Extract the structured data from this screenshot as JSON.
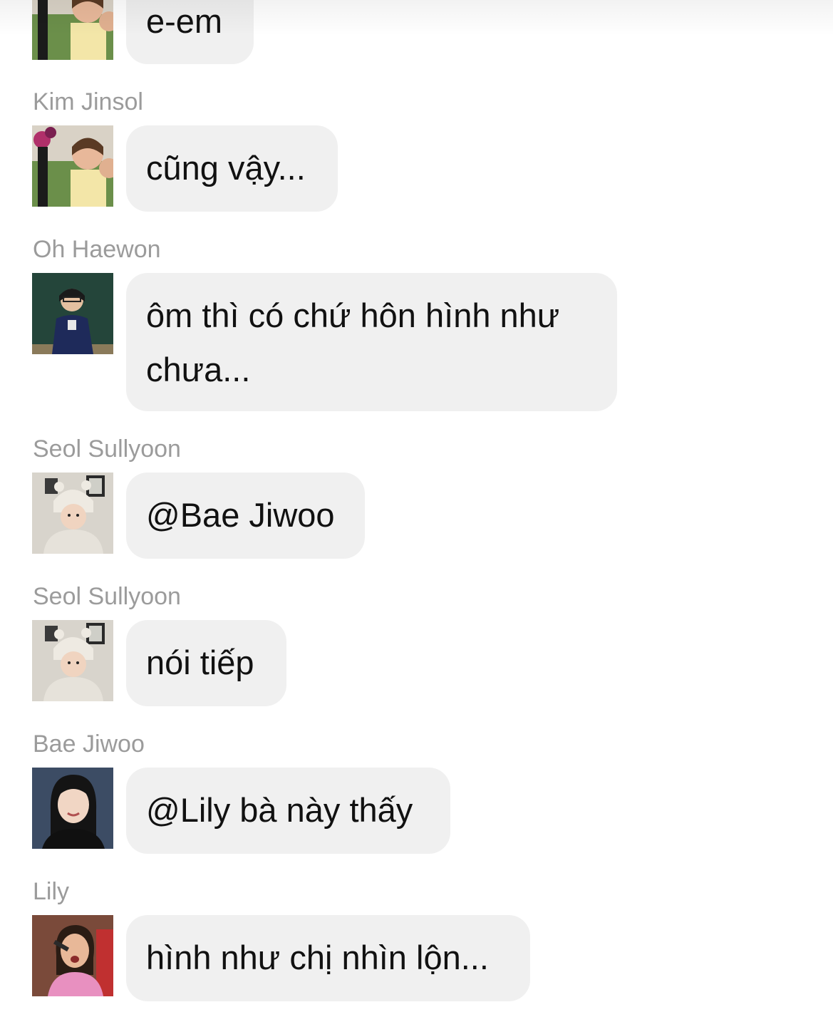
{
  "messages": [
    {
      "sender": "",
      "avatar": "girl-with-flowers-avatar",
      "text": "e-em"
    },
    {
      "sender": "Kim Jinsol",
      "avatar": "girl-with-flowers-avatar",
      "text": "cũng vậy..."
    },
    {
      "sender": "Oh Haewon",
      "avatar": "girl-at-chalkboard-avatar",
      "text": "ôm thì có chứ hôn hình như chưa..."
    },
    {
      "sender": "Seol Sullyoon",
      "avatar": "baby-in-hat-avatar",
      "text": "@Bae Jiwoo"
    },
    {
      "sender": "Seol Sullyoon",
      "avatar": "baby-in-hat-avatar",
      "text": "nói tiếp"
    },
    {
      "sender": "Bae Jiwoo",
      "avatar": "girl-portrait-avatar",
      "text": "@Lily bà này thấy"
    },
    {
      "sender": "Lily",
      "avatar": "girl-singing-avatar",
      "text": "hình như chị nhìn lộn..."
    }
  ],
  "colors": {
    "bubble_background": "#f0f0f0",
    "sender_text": "#9b9b9b",
    "message_text": "#111111",
    "page_background": "#ffffff"
  }
}
